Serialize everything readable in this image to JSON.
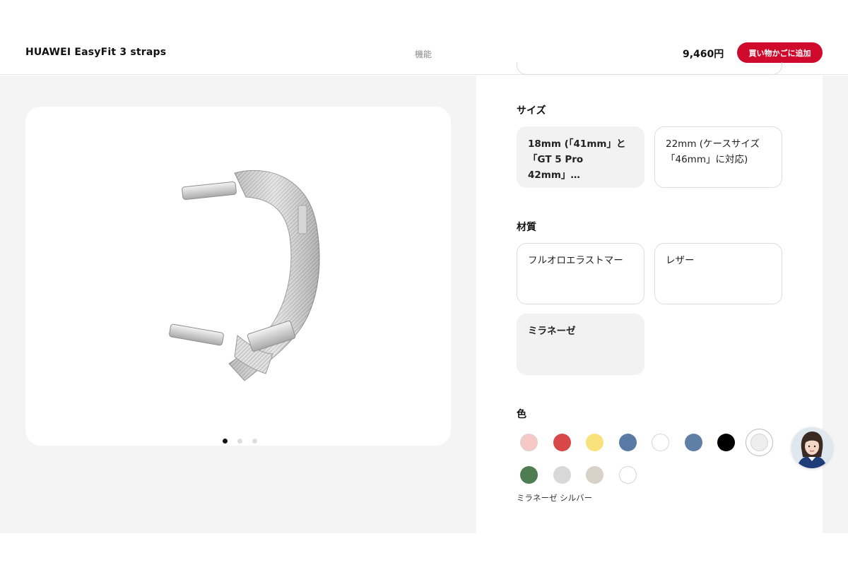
{
  "header": {
    "product_name": "HUAWEI EasyFit 3 straps",
    "nav_features": "機能",
    "price": "9,460円",
    "add_to_cart": "買い物かごに追加"
  },
  "gallery": {
    "image_label": "ミラネーゼ シルバー strap",
    "dot_count": 3,
    "active_dot": 1
  },
  "size": {
    "title": "サイズ",
    "options": [
      {
        "line1": "18mm (「41mm」と",
        "line2": "「GT 5 Pro 42mm」…",
        "selected": true
      },
      {
        "line1": "22mm (ケースサイズ",
        "line2": "「46mm」に対応)",
        "selected": false
      }
    ]
  },
  "material": {
    "title": "材質",
    "options": [
      {
        "label": "フルオロエラストマー",
        "selected": false
      },
      {
        "label": "レザー",
        "selected": false
      },
      {
        "label": "ミラネーゼ",
        "selected": true
      }
    ]
  },
  "color": {
    "title": "色",
    "selected_name": "ミラネーゼ シルバー",
    "swatches_row1": [
      "#f6c9c6",
      "#d94848",
      "#f9e27c",
      "#5a7aa6",
      "#ffffff",
      "#5f7fa6",
      "#000000",
      "#eeeeee"
    ],
    "swatches_row2": [
      "#4e7d52",
      "#d8d8d8",
      "#d7d1c8",
      "#ffffff"
    ],
    "selected_index": 7
  },
  "brand_color": "#cf0a2c"
}
